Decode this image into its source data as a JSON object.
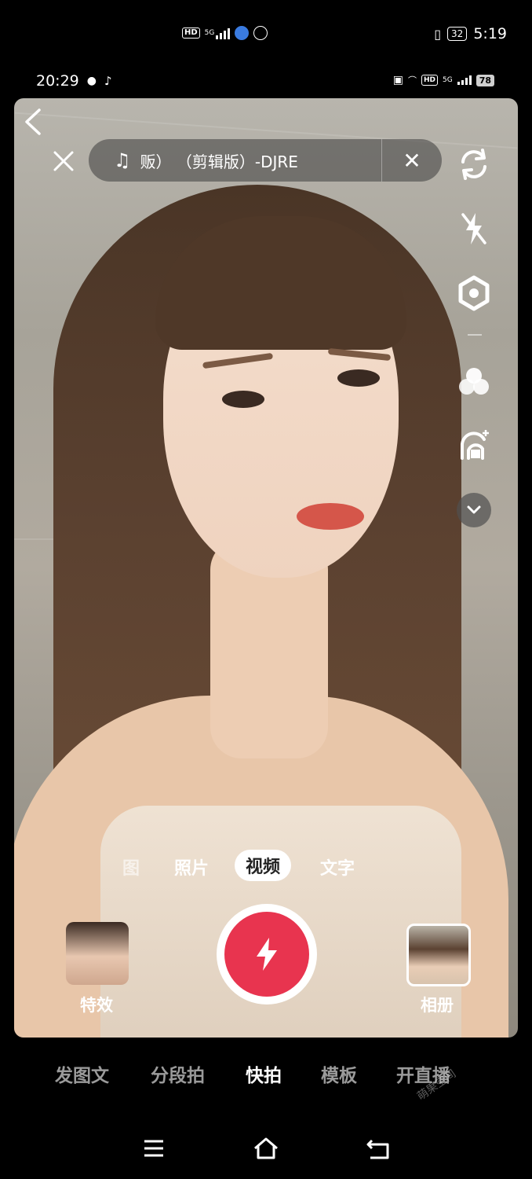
{
  "outer_status": {
    "hd_badge": "HD",
    "network": "5G",
    "battery": "32",
    "time": "5:19"
  },
  "inner_status": {
    "time": "20:29",
    "hd_badge": "HD",
    "network": "5G",
    "battery": "78"
  },
  "music": {
    "title": "贩） （剪辑版）-DJRE"
  },
  "modes": [
    "图",
    "照片",
    "视频",
    "文字"
  ],
  "active_mode": "视频",
  "effects_label": "特效",
  "album_label": "相册",
  "bottom_tabs": [
    "发图文",
    "分段拍",
    "快拍",
    "模板",
    "开直播"
  ],
  "active_tab": "快拍",
  "watermark": "萌果空间",
  "colors": {
    "shutter": "#e8344f",
    "background": "#000000"
  },
  "icons": [
    "back-icon",
    "close-icon",
    "music-note-icon",
    "flip-camera-icon",
    "flash-off-icon",
    "settings-icon",
    "filter-icon",
    "beauty-icon",
    "chevron-down-icon",
    "lightning-icon",
    "menu-icon",
    "home-icon",
    "back-nav-icon"
  ]
}
